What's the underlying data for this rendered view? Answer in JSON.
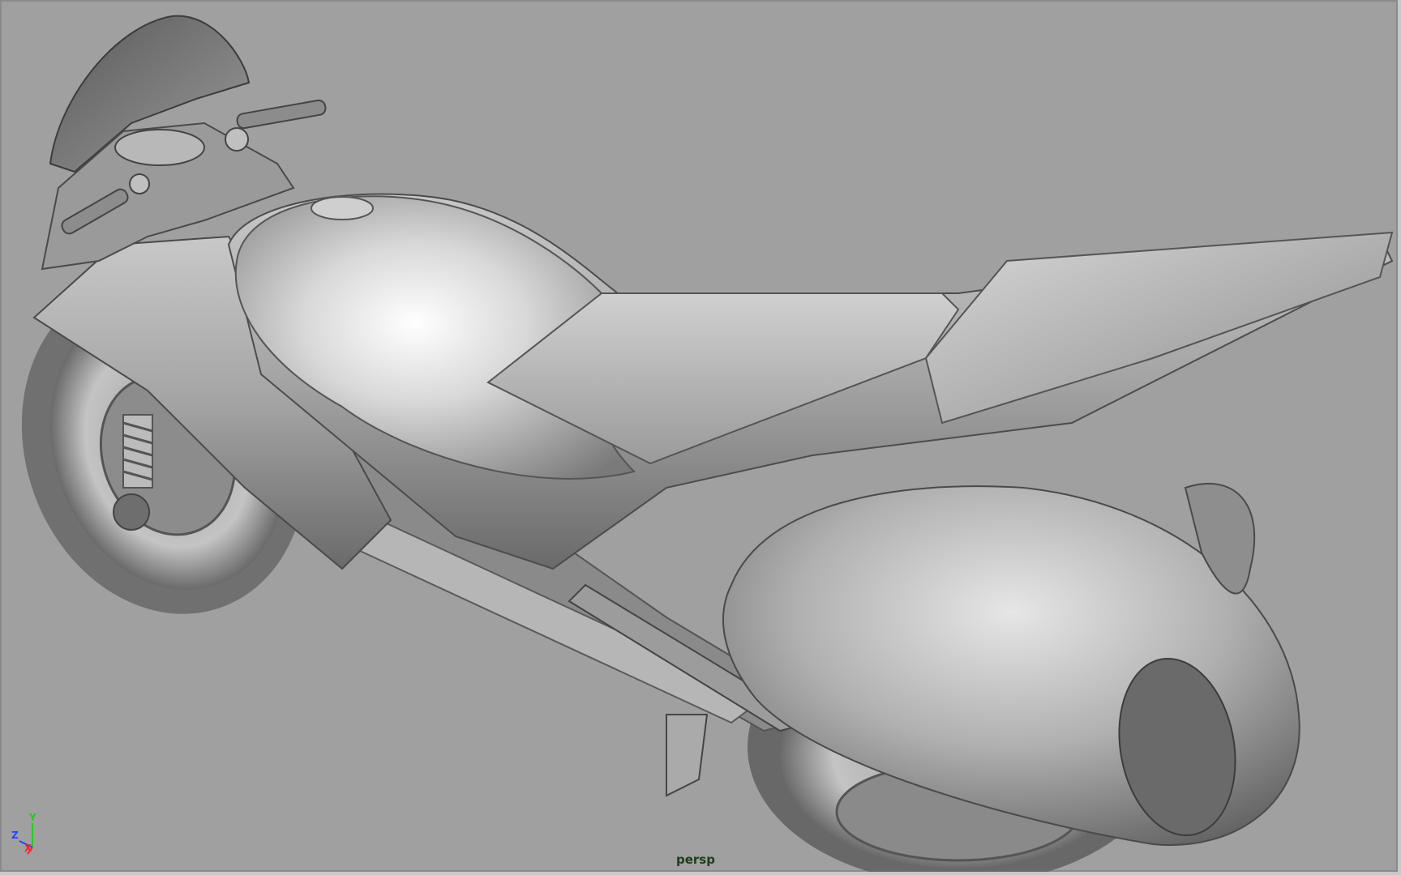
{
  "viewport": {
    "camera_name": "persp",
    "background_color": "#a0a0a0",
    "model": "motorcycle-shaded"
  },
  "axis_gizmo": {
    "y_label": "Y",
    "z_label": "Z",
    "x_label": "X",
    "y_color": "#22cc22",
    "z_color": "#2244ff",
    "x_color": "#ff2222"
  }
}
